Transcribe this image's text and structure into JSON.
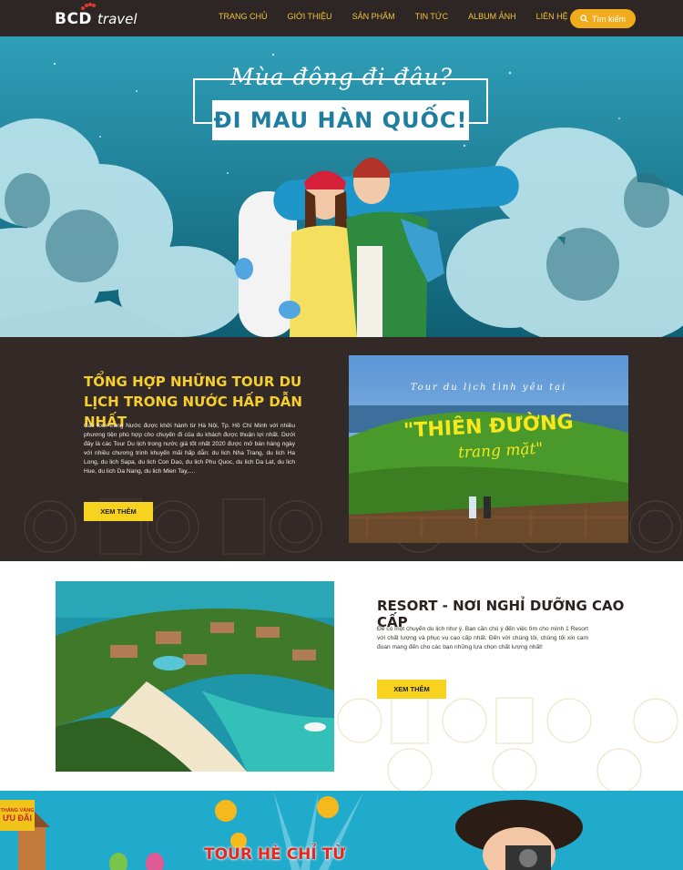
{
  "header": {
    "logo_main": "BCD",
    "logo_sub": "travel",
    "nav": [
      "TRANG CHỦ",
      "GIỚI THIỆU",
      "SẢN PHẨM",
      "TIN TỨC",
      "ALBUM ẢNH",
      "LIÊN HỆ"
    ],
    "search_label": "Tìm kiếm"
  },
  "hero": {
    "script_line": "Mùa đông đi đâu?",
    "headline": "ĐI MAU HÀN QUỐC!"
  },
  "section_tours": {
    "title": "TỔNG HỢP NHỮNG TOUR DU LỊCH TRONG NƯỚC HẤP DẪN NHẤT",
    "description": "Các tour trong Nước được khởi hành từ Hà Nội, Tp. Hồ Chí Minh với nhiều phương tiện phù hợp cho chuyến đi của du khách được thuận lợi nhất. Dưới đây là các Tour Du lịch trong nước giá tốt nhất 2020 được mở bán hàng ngày với nhiều chương trình khuyến mãi hấp dẫn: du lich Nha Trang, du lich Ha Long, du lich Sapa, du lich Con Dao, du lich Phu Quoc, du lich Da Lat, du lich Hue, du lich Da Nang, du lich Mien Tay,....",
    "button": "XEM THÊM",
    "image_caption_top": "Tour du lịch tình yêu tại",
    "image_caption_big": "\"THIÊN ĐƯỜNG",
    "image_caption_small": "trang mặt\""
  },
  "section_resort": {
    "title": "RESORT - NƠI NGHỈ DƯỠNG CAO CẤP",
    "description": "Để có một chuyến du lịch như ý. Bạn cần chú ý đến việc tìm cho mình 1 Resort với chất lượng và phục vụ cao cấp nhất. Đến với chúng tôi, chúng tôi xin cam đoan mang đến cho các bạn những lựa chọn chất lượng nhất!",
    "button": "XEM THÊM"
  },
  "section_banner": {
    "tag_line1": "THÁNG VÀNG",
    "tag_line2": "ƯU ĐÃI",
    "title": "TOUR HÈ CHỈ TỪ"
  },
  "colors": {
    "header_bg": "#2d2625",
    "accent_yellow": "#f7d21f",
    "nav_text": "#f3c53c",
    "search_orange": "#f1ac1e",
    "dark_section": "#332a28"
  }
}
